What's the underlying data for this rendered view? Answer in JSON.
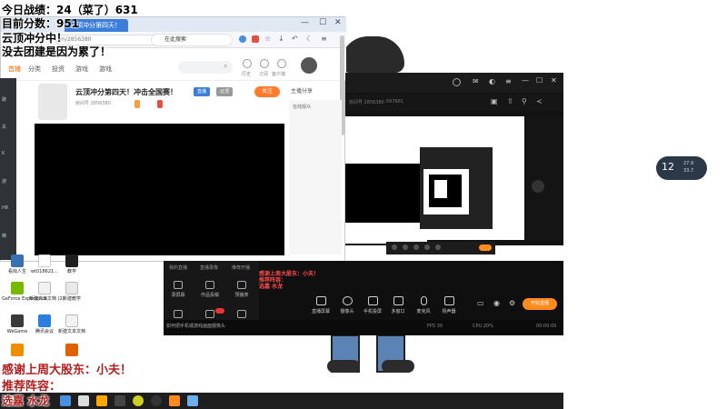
{
  "overlay": {
    "line1": "今日战绩：24（菜了）631",
    "line2": "目前分数：951",
    "line3": "云顶冲分中！",
    "line4": "没去团建是因为累了！",
    "bottom1": "感谢上周大股东：小夫！",
    "bottom2": "推荐阵容：",
    "bottom3": "选嘉 水龙"
  },
  "browser": {
    "tab_label": "云顶冲分第四天！",
    "address": "m/2856380",
    "search_placeholder": "在此搜索",
    "nav": [
      "首播",
      "分类",
      "投资",
      "游戏",
      "游戏"
    ],
    "nav_active_index": 0,
    "header_icons": [
      {
        "icon": "clock-icon",
        "label": "历史"
      },
      {
        "icon": "heart-icon",
        "label": "订阅"
      },
      {
        "icon": "gift-icon",
        "label": "客户端"
      }
    ]
  },
  "stream": {
    "title": "云顶冲分第四天！冲击全国赛！",
    "tags": [
      "直播",
      "云顶"
    ],
    "follow_label": "关注",
    "meta": "房间号 2856380",
    "side_links": "主播分享",
    "side_panel_title": "在线观众"
  },
  "left_strip": [
    "聊",
    "关",
    "K",
    "游",
    "HR",
    "精"
  ],
  "app": {
    "room_label": "房间号 2856380",
    "fans_label": "697661"
  },
  "widget": {
    "number": "12",
    "lines": [
      "27.9",
      "33.7"
    ]
  },
  "panel": {
    "tabs": [
      "我的直播",
      "直播录像",
      "推荐开播"
    ],
    "left_items": [
      {
        "icon": "video-icon",
        "label": "录屏幕"
      },
      {
        "icon": "upload-icon",
        "label": "作品投稿"
      },
      {
        "icon": "calendar-icon",
        "label": "预播表"
      }
    ],
    "left_items2": [
      {
        "icon": "scene-icon",
        "label": "场景"
      },
      {
        "icon": "new-icon",
        "label": "新"
      },
      {
        "icon": "download-icon",
        "label": "下载"
      }
    ],
    "controls": [
      {
        "icon": "screen-share-icon",
        "label": "直播屏幕"
      },
      {
        "icon": "camera-icon",
        "label": "摄像头"
      },
      {
        "icon": "phone-cast-icon",
        "label": "手机投屏"
      },
      {
        "icon": "multi-window-icon",
        "label": "多窗口"
      },
      {
        "icon": "mic-icon",
        "label": "麦克风"
      },
      {
        "icon": "speaker-icon",
        "label": "扬声器"
      }
    ],
    "start_label": "开始直播",
    "tip": "如何把手机或游戏画面摄像头",
    "status": [
      "FPS 30",
      "CPU 20%",
      "00:00:00"
    ]
  },
  "nested_text": {
    "t1": "感谢上周大股东：小夫！",
    "t2": "推荐阵容：",
    "t3": "选嘉 水龙"
  },
  "desktop": [
    {
      "label": "看戏人生",
      "color": "#3a6fb0"
    },
    {
      "label": "wt018621...",
      "color": "#ffffff"
    },
    {
      "label": "教学",
      "color": "#1f1f1f"
    },
    {
      "label": "GeForce Experience",
      "color": "#76b900"
    },
    {
      "label": "新建文本文档 (2)",
      "color": "#f2f2f2"
    },
    {
      "label": "新建教学",
      "color": "#e9e9e9"
    },
    {
      "label": "WeGame",
      "color": "#3a3a3a"
    },
    {
      "label": "腾讯会议",
      "color": "#2a7de1"
    },
    {
      "label": "新建文本文档",
      "color": "#f2f2f2"
    },
    {
      "label": "",
      "color": "#f08c00"
    },
    {
      "label": "",
      "color": "#e06000"
    }
  ],
  "taskbar": [
    {
      "icon": "search-icon",
      "color": "#4a90e2"
    },
    {
      "icon": "file-icon",
      "color": "#dddddd"
    },
    {
      "icon": "app-g-icon",
      "color": "#ffa600"
    },
    {
      "icon": "app-c-icon",
      "color": "#444444"
    },
    {
      "icon": "chrome-icon",
      "color": "#cfcf22"
    },
    {
      "icon": "obs-icon",
      "color": "#333333"
    },
    {
      "icon": "app-orange-icon",
      "color": "#ff8a1e"
    },
    {
      "icon": "huya-icon",
      "color": "#6dafe8"
    }
  ]
}
